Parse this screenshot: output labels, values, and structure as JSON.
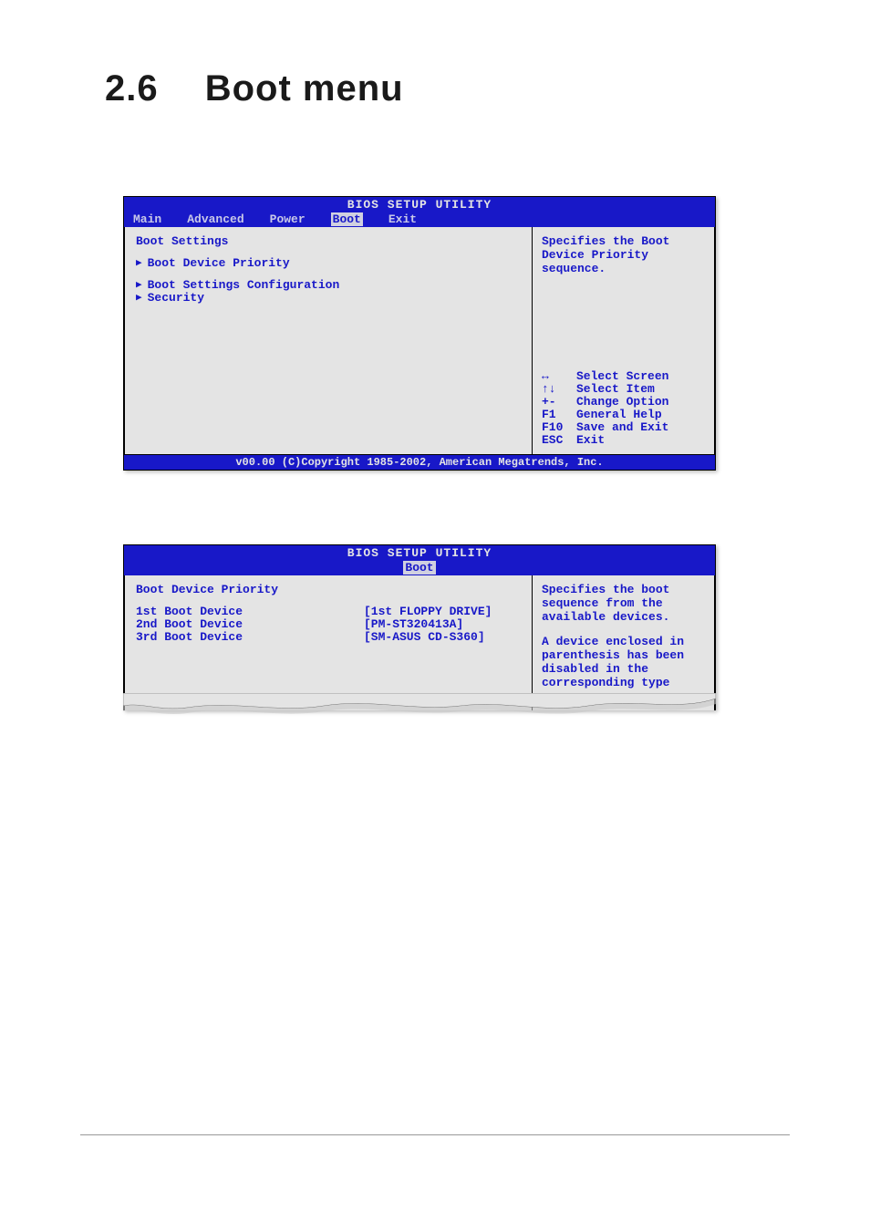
{
  "section": {
    "number": "2.6",
    "title": "Boot menu"
  },
  "bios1": {
    "title": "BIOS SETUP UTILITY",
    "tabs": [
      "Main",
      "Advanced",
      "Power",
      "Boot",
      "Exit"
    ],
    "active_tab": "Boot",
    "heading": "Boot Settings",
    "items": [
      "Boot Device Priority",
      "Boot Settings Configuration",
      "Security"
    ],
    "help1": "Specifies the Boot Device Priority sequence.",
    "keys": [
      {
        "k": "↔",
        "d": "Select Screen"
      },
      {
        "k": "↑↓",
        "d": "Select Item"
      },
      {
        "k": "+-",
        "d": "Change Option"
      },
      {
        "k": "F1",
        "d": "General Help"
      },
      {
        "k": "F10",
        "d": "Save and Exit"
      },
      {
        "k": "ESC",
        "d": "Exit"
      }
    ],
    "footer": "v00.00 (C)Copyright 1985-2002, American Megatrends, Inc."
  },
  "bios2": {
    "title": "BIOS SETUP UTILITY",
    "active_tab": "Boot",
    "heading": "Boot Device Priority",
    "rows": [
      {
        "lbl": "1st Boot Device",
        "val": "[1st FLOPPY DRIVE]"
      },
      {
        "lbl": "2nd Boot Device",
        "val": "[PM-ST320413A]"
      },
      {
        "lbl": "3rd Boot Device",
        "val": "[SM-ASUS CD-S360]"
      }
    ],
    "help1": "Specifies the boot sequence from the available devices.",
    "help2": "A device enclosed in parenthesis has been disabled in the corresponding type menu."
  }
}
